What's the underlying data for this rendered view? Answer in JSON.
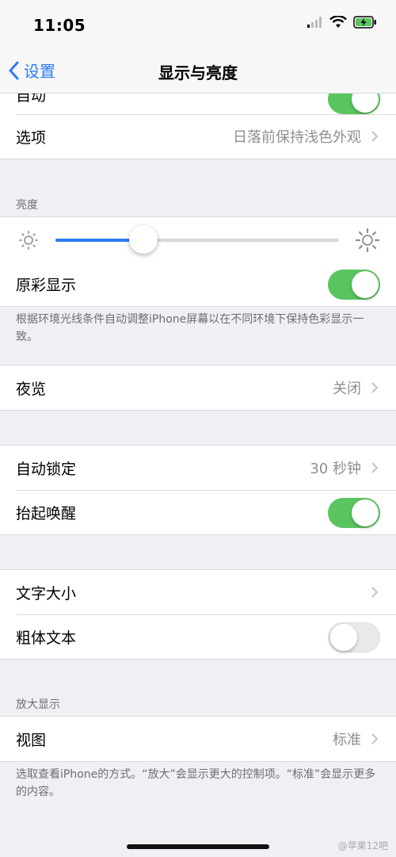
{
  "status": {
    "time": "11:05"
  },
  "nav": {
    "back_label": "设置",
    "title": "显示与亮度"
  },
  "top_partial": {
    "label": "自动",
    "toggle_on": true
  },
  "appearance_options": {
    "label": "选项",
    "value": "日落前保持浅色外观"
  },
  "brightness": {
    "header": "亮度",
    "level": 0.31
  },
  "true_tone": {
    "label": "原彩显示",
    "toggle_on": true,
    "note": "根据环境光线条件自动调整iPhone屏幕以在不同环境下保持色彩显示一致。"
  },
  "night_shift": {
    "label": "夜览",
    "value": "关闭"
  },
  "auto_lock": {
    "label": "自动锁定",
    "value": "30 秒钟"
  },
  "raise_to_wake": {
    "label": "抬起唤醒",
    "toggle_on": true
  },
  "text_size": {
    "label": "文字大小"
  },
  "bold_text": {
    "label": "粗体文本",
    "toggle_on": false
  },
  "zoom": {
    "header": "放大显示",
    "view_label": "视图",
    "view_value": "标准",
    "note": "选取查看iPhone的方式。“放大”会显示更大的控制项。“标准”会显示更多的内容。"
  },
  "watermark": "@苹果12吧",
  "colors": {
    "accent": "#2f7bf5",
    "toggle_on": "#5ac55f",
    "background": "#efeff4"
  }
}
